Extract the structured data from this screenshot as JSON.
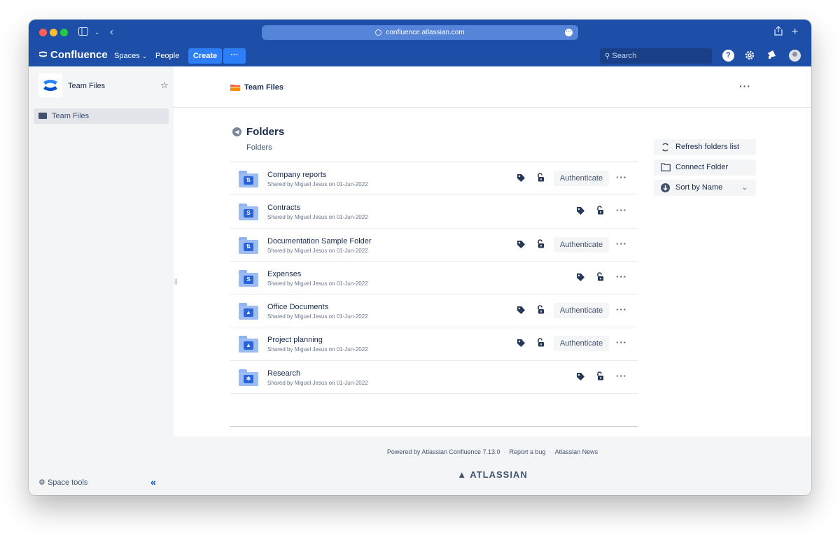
{
  "browser": {
    "url": "confluence.atlassian.com"
  },
  "nav": {
    "brand": "Confluence",
    "spaces": "Spaces",
    "people": "People",
    "create": "Create",
    "more": "···",
    "search_placeholder": "Search",
    "help": "?"
  },
  "sidebar": {
    "space_name": "Team Files",
    "items": [
      {
        "label": "Team Files"
      }
    ],
    "space_tools": "Space tools",
    "collapse": "«"
  },
  "header": {
    "title": "Team Files",
    "more": "···"
  },
  "main": {
    "section_title": "Folders",
    "section_subtitle": "Folders",
    "auth_label": "Authenticate",
    "folders": [
      {
        "name": "Company reports",
        "meta": "Shared by Miguel Jesus on 01-Jun-2022",
        "provider": "dropbox-icon",
        "badge": "⇅",
        "authenticate": true
      },
      {
        "name": "Contracts",
        "meta": "Shared by Miguel Jesus on 01-Jun-2022",
        "provider": "sharepoint-icon",
        "badge": "S",
        "authenticate": false
      },
      {
        "name": "Documentation Sample Folder",
        "meta": "Shared by Miguel Jesus on 01-Jun-2022",
        "provider": "dropbox-icon",
        "badge": "⇅",
        "authenticate": true
      },
      {
        "name": "Expenses",
        "meta": "Shared by Miguel Jesus on 01-Jun-2022",
        "provider": "sharepoint-icon",
        "badge": "S",
        "authenticate": false
      },
      {
        "name": "Office Documents",
        "meta": "Shared by Miguel Jesus on 01-Jun-2022",
        "provider": "google-drive-icon",
        "badge": "▲",
        "authenticate": true
      },
      {
        "name": "Project planning",
        "meta": "Shared by Miguel Jesus on 01-Jun-2022",
        "provider": "google-drive-icon",
        "badge": "▲",
        "authenticate": true
      },
      {
        "name": "Research",
        "meta": "Shared by Miguel Jesus on 01-Jun-2022",
        "provider": "box-icon",
        "badge": "✱",
        "authenticate": false
      }
    ]
  },
  "actions": {
    "refresh": "Refresh folders list",
    "connect": "Connect Folder",
    "sort": "Sort by Name"
  },
  "footer": {
    "powered_by": "Powered by Atlassian Confluence 7.13.0",
    "report_bug": "Report a bug",
    "news": "Atlassian News",
    "brand": "ATLASSIAN",
    "sep": "·"
  },
  "colors": {
    "nav_bg": "#1d4fa8",
    "create_btn": "#2d7ff9",
    "sidebar_bg": "#f4f5f7",
    "folder_badge": "#2b64d8"
  }
}
